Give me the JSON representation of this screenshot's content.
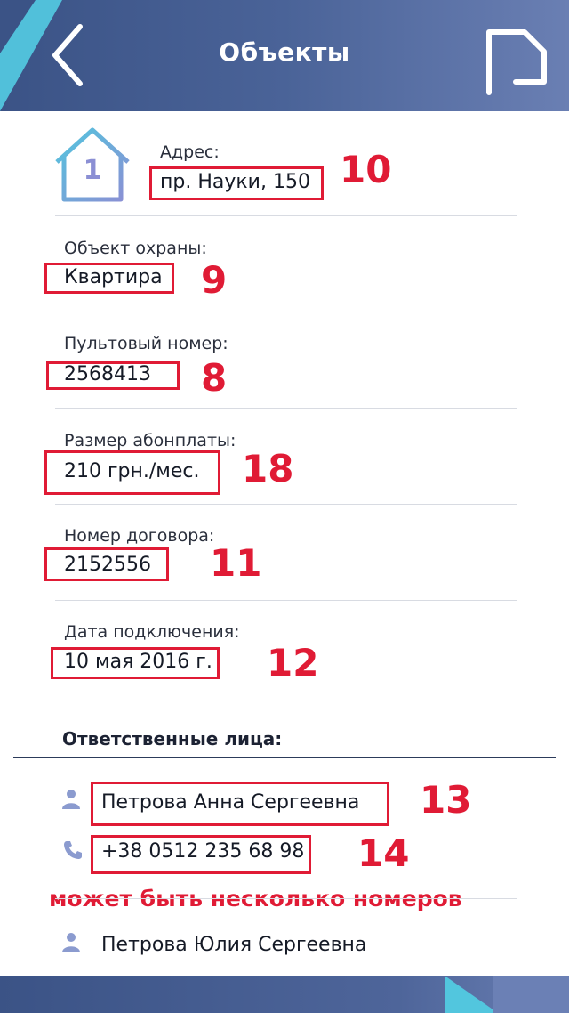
{
  "header": {
    "title": "Объекты"
  },
  "object": {
    "number": "1"
  },
  "fields": [
    {
      "label": "Адрес:",
      "value": "пр. Науки, 150",
      "marker": "10"
    },
    {
      "label": "Объект охраны:",
      "value": "Квартира",
      "marker": "9"
    },
    {
      "label": "Пультовый номер:",
      "value": "2568413",
      "marker": "8"
    },
    {
      "label": "Размер абонплаты:",
      "value": "210 грн./мес.",
      "marker": "18"
    },
    {
      "label": "Номер договора:",
      "value": "2152556",
      "marker": "11"
    },
    {
      "label": "Дата подключения:",
      "value": "10 мая 2016 г.",
      "marker": "12"
    }
  ],
  "responsible": {
    "title": "Ответственные лица:",
    "persons": [
      {
        "name": "Петрова Анна Сергеевна",
        "name_marker": "13",
        "phone": "+38 0512 235 68 98",
        "phone_marker": "14"
      },
      {
        "name": "Петрова Юлия Сергеевна"
      }
    ],
    "note": "может быть несколько номеров"
  },
  "colors": {
    "header": "#4a6398",
    "accent_cyan": "#52c6de",
    "annotation_red": "#e01b35",
    "icon_blue": "#8b9bcf"
  }
}
